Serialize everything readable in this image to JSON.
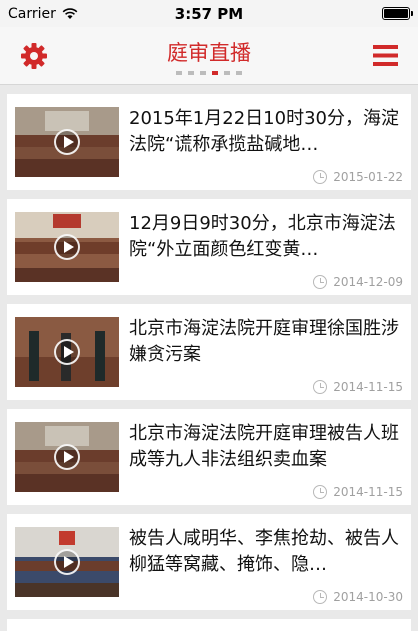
{
  "status": {
    "carrier": "Carrier",
    "time": "3:57 PM"
  },
  "nav": {
    "title": "庭审直播",
    "settings_icon": "gear-icon",
    "menu_icon": "hamburger-menu-icon",
    "accent": "#d12a2a"
  },
  "pager": {
    "count": 6,
    "active_index": 3
  },
  "items": [
    {
      "title": "2015年1月22日10时30分，海淀法院“谎称承揽盐碱地…",
      "date": "2015-01-22"
    },
    {
      "title": "12月9日9时30分，北京市海淀法院“外立面颜色红变黄…",
      "date": "2014-12-09"
    },
    {
      "title": "北京市海淀法院开庭审理徐国胜涉嫌贪污案",
      "date": "2014-11-15"
    },
    {
      "title": "北京市海淀法院开庭审理被告人班成等九人非法组织卖血案",
      "date": "2014-11-15"
    },
    {
      "title": "被告人咸明华、李焦抢劫、被告人柳猛等窝藏、掩饰、隐…",
      "date": "2014-10-30"
    }
  ]
}
